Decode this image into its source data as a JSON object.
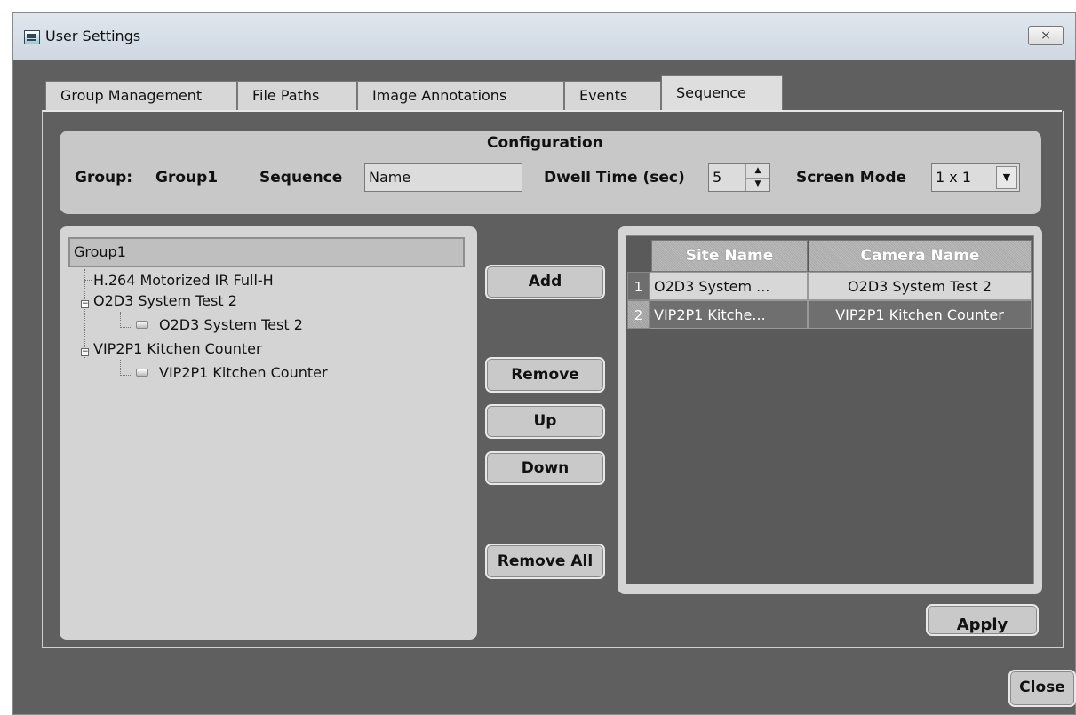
{
  "window": {
    "title": "User Settings",
    "close_glyph": "⨯"
  },
  "tabs": [
    {
      "label": "Group Management",
      "active": false
    },
    {
      "label": "File Paths",
      "active": false
    },
    {
      "label": "Image Annotations",
      "active": false
    },
    {
      "label": "Events",
      "active": false
    },
    {
      "label": "Sequence",
      "active": true
    }
  ],
  "config": {
    "heading": "Configuration",
    "group_label": "Group:",
    "group_value": "Group1",
    "sequence_label": "Sequence",
    "sequence_value": "Name",
    "dwell_label": "Dwell Time (sec)",
    "dwell_value": "5",
    "screen_mode_label": "Screen Mode",
    "screen_mode_value": "1 x 1"
  },
  "tree": {
    "root": "Group1",
    "items": [
      {
        "label": "H.264 Motorized IR Full-H"
      },
      {
        "label": "O2D3 System Test 2",
        "child": "O2D3 System Test 2"
      },
      {
        "label": "VIP2P1 Kitchen Counter",
        "child": "VIP2P1 Kitchen Counter"
      }
    ]
  },
  "buttons": {
    "add": "Add",
    "remove": "Remove",
    "up": "Up",
    "down": "Down",
    "remove_all": "Remove All",
    "apply": "Apply",
    "close": "Close"
  },
  "grid": {
    "columns": [
      "Site Name",
      "Camera Name"
    ],
    "rows": [
      {
        "num": "1",
        "site": "O2D3 System ...",
        "camera": "O2D3 System Test 2"
      },
      {
        "num": "2",
        "site": "VIP2P1 Kitche...",
        "camera": "VIP2P1 Kitchen Counter"
      }
    ]
  },
  "icons": {
    "app": "window-settings-icon",
    "expander": "minus-expander-icon",
    "camera": "camera-icon",
    "spin_up": "spin-up-icon",
    "spin_down": "spin-down-icon",
    "dropdown": "dropdown-arrow-icon"
  }
}
